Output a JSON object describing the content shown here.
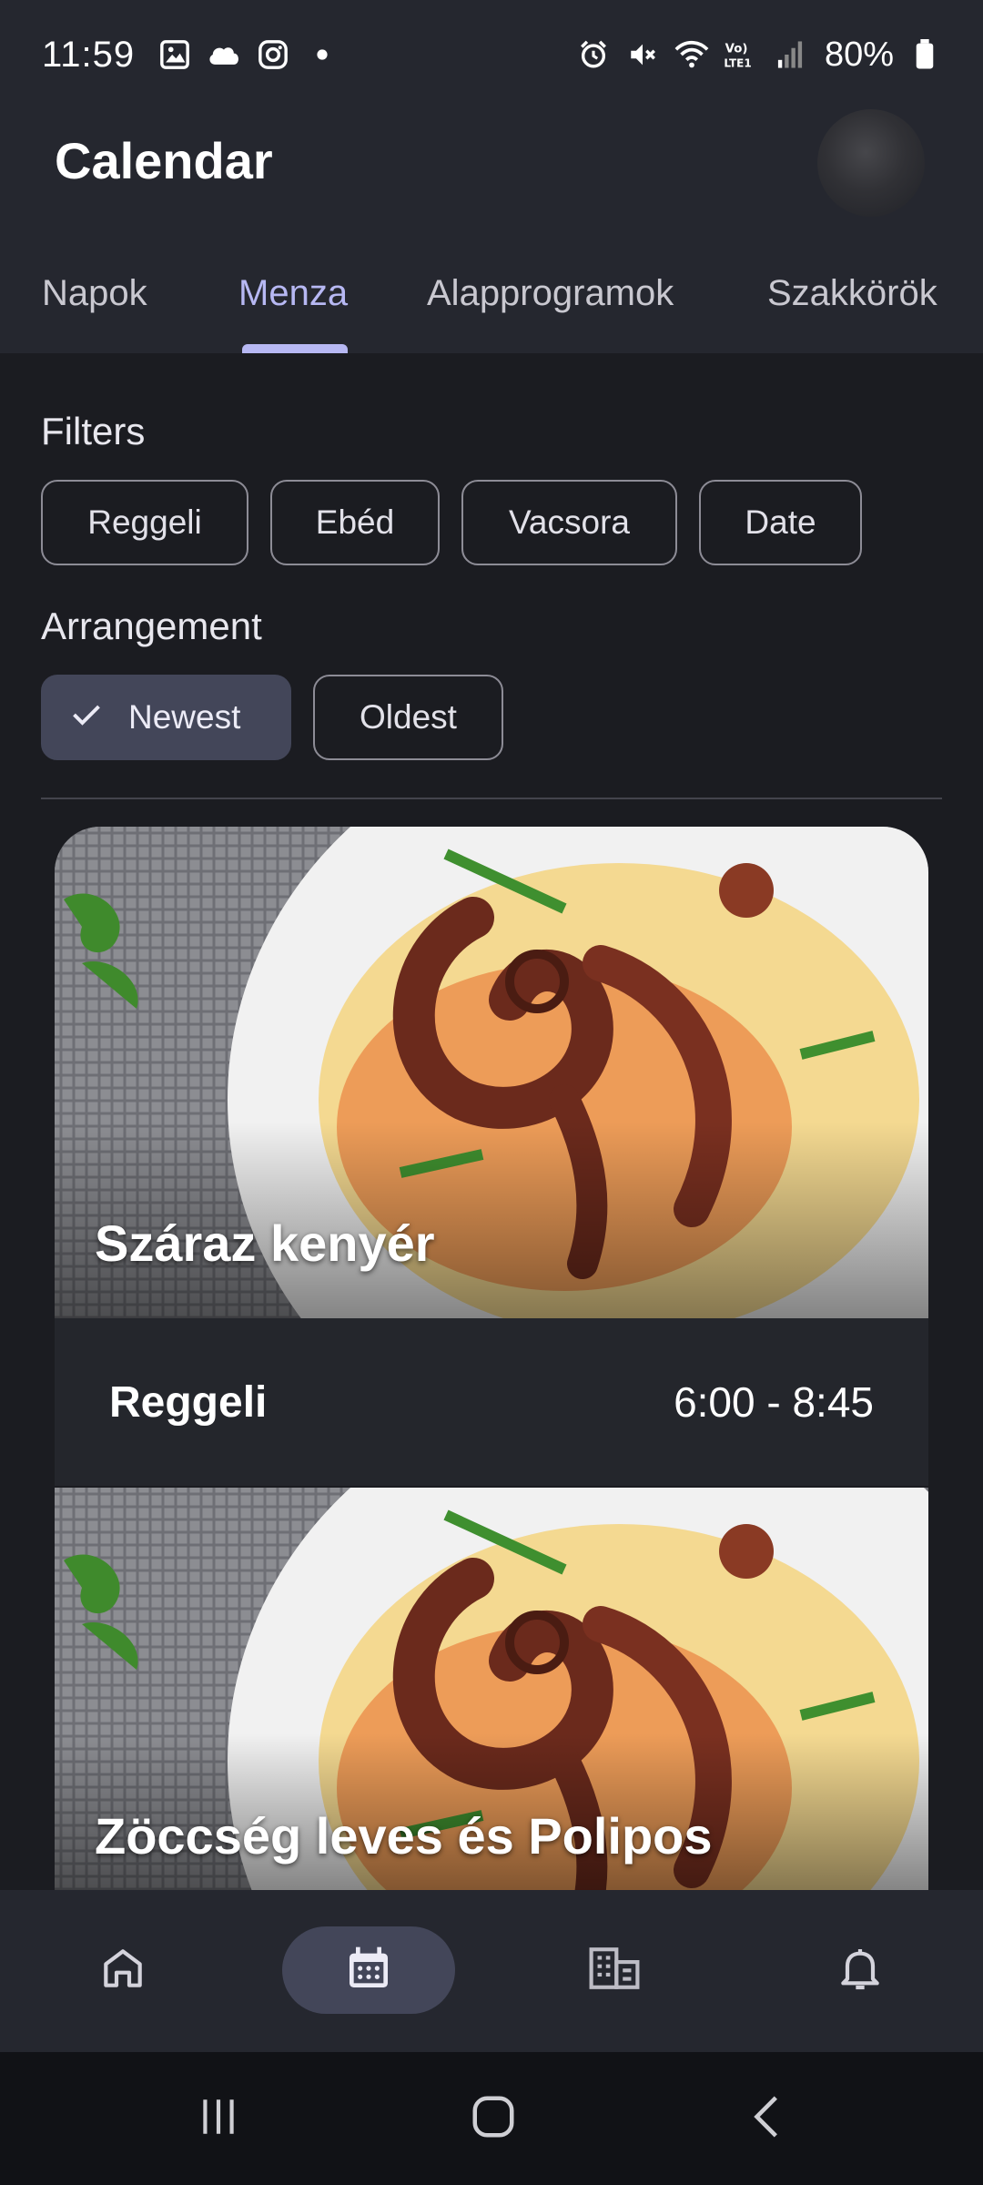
{
  "status_bar": {
    "time": "11:59",
    "battery": "80%",
    "left_icons": [
      "gallery-icon",
      "cloud-icon",
      "instagram-icon",
      "dot-icon"
    ],
    "right_icons": [
      "alarm-icon",
      "mute-icon",
      "wifi-icon",
      "volte-icon",
      "signal-icon",
      "battery-icon"
    ]
  },
  "app": {
    "title": "Calendar"
  },
  "tabs": [
    {
      "label": "Napok",
      "active": false
    },
    {
      "label": "Menza",
      "active": true
    },
    {
      "label": "Alapprogramok",
      "active": false
    },
    {
      "label": "Szakkörök",
      "active": false
    }
  ],
  "filters": {
    "label": "Filters",
    "chips": [
      "Reggeli",
      "Ebéd",
      "Vacsora",
      "Date"
    ]
  },
  "arrangement": {
    "label": "Arrangement",
    "options": [
      {
        "label": "Newest",
        "selected": true
      },
      {
        "label": "Oldest",
        "selected": false
      }
    ]
  },
  "meals": [
    {
      "title": "Száraz kenyér",
      "type": "Reggeli",
      "time": "6:00 - 8:45"
    },
    {
      "title": "Zöccség leves és Polipos",
      "type": "",
      "time": ""
    }
  ],
  "bottom_nav": [
    {
      "icon": "home-icon",
      "active": false
    },
    {
      "icon": "calendar-icon",
      "active": true
    },
    {
      "icon": "building-icon",
      "active": false
    },
    {
      "icon": "bell-icon",
      "active": false
    }
  ],
  "colors": {
    "accent": "#b7b8f3",
    "surface": "#25272f",
    "background": "#1b1c21",
    "selected_chip": "#434659"
  }
}
